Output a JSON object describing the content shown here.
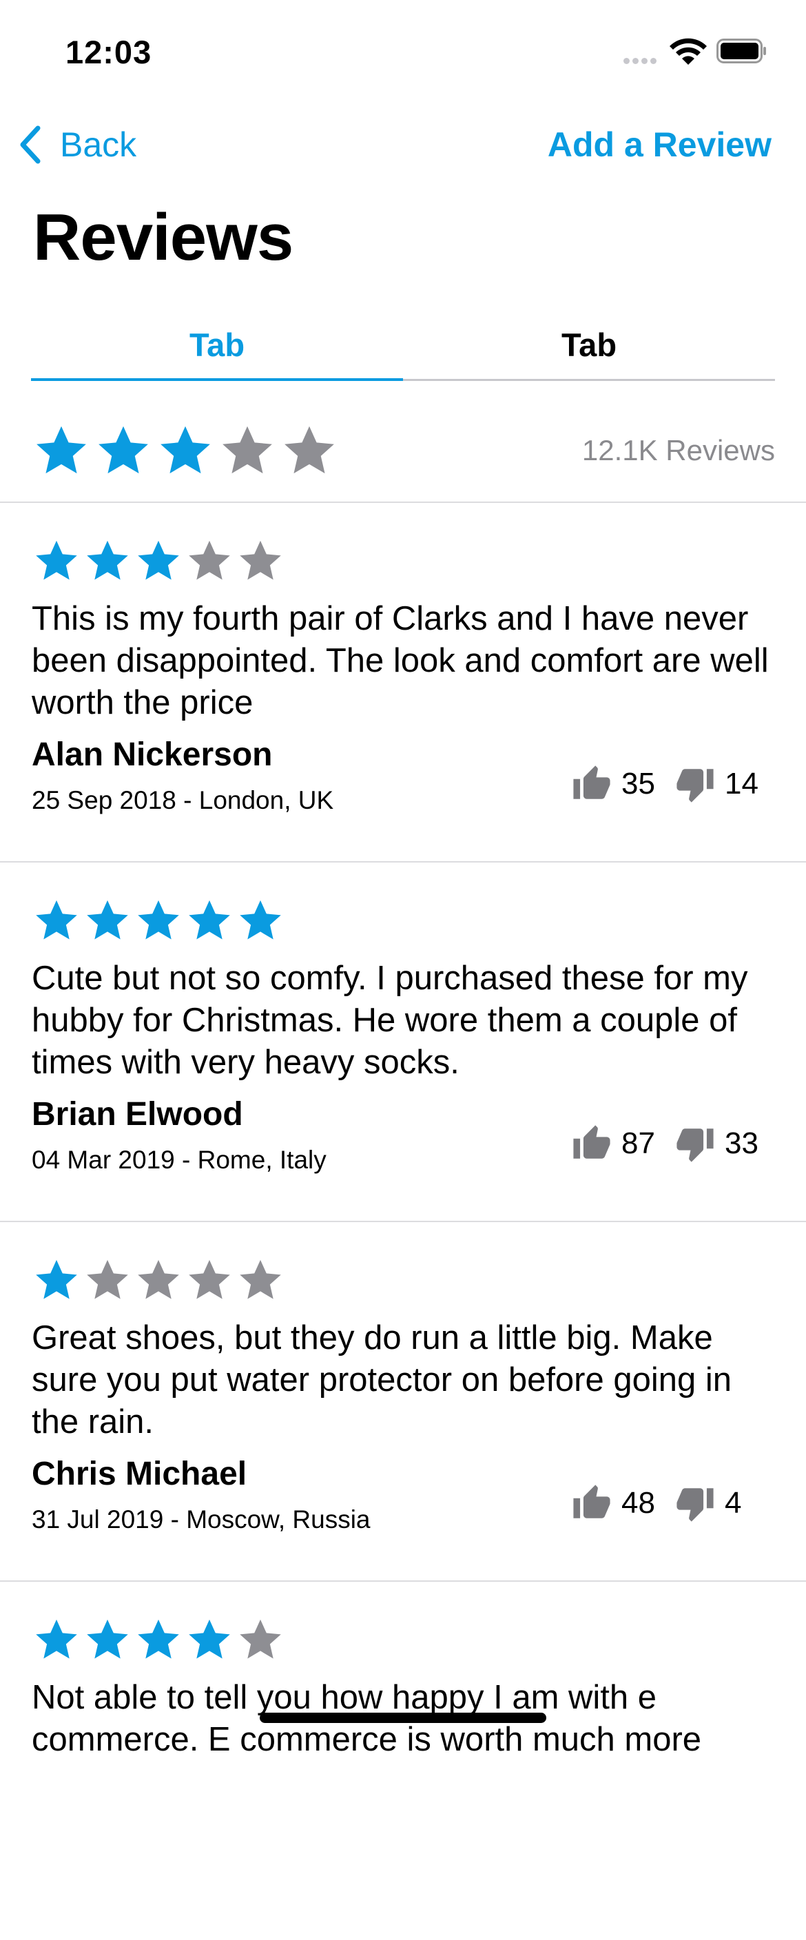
{
  "status_bar": {
    "time": "12:03"
  },
  "nav": {
    "back_label": "Back",
    "add_review_label": "Add a Review"
  },
  "page_title": "Reviews",
  "tabs": [
    {
      "label": "Tab",
      "active": true
    },
    {
      "label": "Tab",
      "active": false
    }
  ],
  "summary": {
    "rating": 3,
    "max_rating": 5,
    "count_label": "12.1K Reviews"
  },
  "reviews": [
    {
      "rating": 3,
      "text": "This is my fourth pair of Clarks and I have never been disappointed. The look and comfort are well worth the price",
      "author": "Alan Nickerson",
      "meta": "25 Sep 2018  - London, UK",
      "likes": "35",
      "dislikes": "14"
    },
    {
      "rating": 5,
      "text": "Cute but not so comfy. I purchased these for my hubby for Christmas. He wore them a couple of times with very heavy socks.",
      "author": "Brian Elwood",
      "meta": "04 Mar 2019 - Rome, Italy",
      "likes": "87",
      "dislikes": "33"
    },
    {
      "rating": 1,
      "text": "Great shoes, but they do run a little big. Make sure you put water protector on before going in the rain.",
      "author": "Chris Michael",
      "meta": "31 Jul 2019 - Moscow, Russia",
      "likes": "48",
      "dislikes": "4"
    },
    {
      "rating": 4,
      "text": "Not able to tell you how happy I am with e commerce. E commerce is worth much more",
      "author": "",
      "meta": "",
      "likes": "",
      "dislikes": ""
    }
  ],
  "colors": {
    "accent": "#0a9be0",
    "star_inactive": "#8e8e93",
    "divider": "#dcdcdf",
    "secondary_text": "#8a8a8e"
  },
  "icons": [
    "chevron-left-icon",
    "star-icon",
    "thumbs-up-icon",
    "thumbs-down-icon",
    "wifi-icon",
    "battery-icon",
    "signal-icon"
  ]
}
